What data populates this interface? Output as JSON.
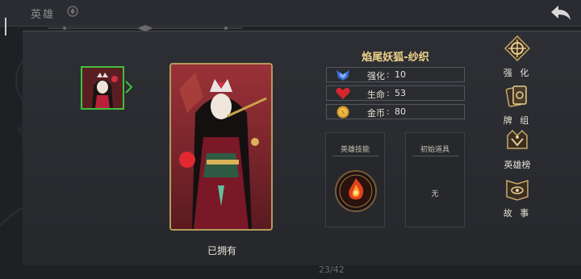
{
  "top_bar": {
    "title": "英雄",
    "tab_icon": "hero-tab-icon",
    "back_icon": "back-arrow-icon"
  },
  "hero": {
    "name": "焰尾妖狐-纱织",
    "owned_label": "已拥有",
    "stats": [
      {
        "icon": "blue-wing-icon",
        "label": "强化",
        "value": "10"
      },
      {
        "icon": "red-heart-icon",
        "label": "生命",
        "value": "53"
      },
      {
        "icon": "gold-coin-icon",
        "label": "金币",
        "value": "80"
      }
    ],
    "skill_box_title": "英雄技能",
    "item_box_title": "初始道具",
    "item_box_value": "无"
  },
  "side_menu": [
    {
      "label": "强 化",
      "icon": "enhance-icon"
    },
    {
      "label": "牌 组",
      "icon": "card-deck-icon"
    },
    {
      "label": "英雄榜",
      "icon": "hero-ranking-icon"
    },
    {
      "label": "故 事",
      "icon": "story-icon"
    }
  ],
  "pagination": "23/42",
  "colors": {
    "accent_gold": "#b59a5a",
    "selected_green": "#3fbf3f",
    "name_gold": "#f0d48a"
  }
}
